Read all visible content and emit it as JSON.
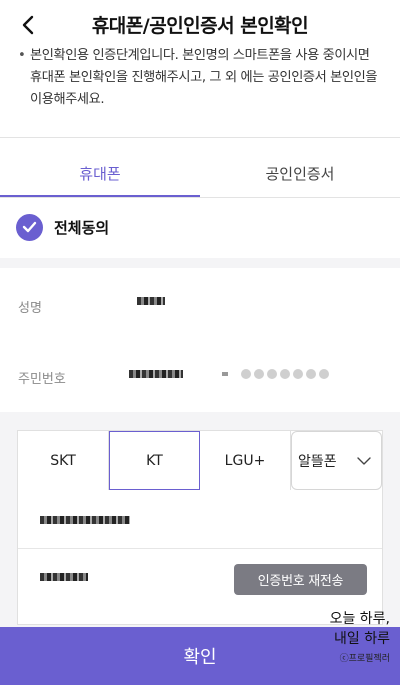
{
  "header": {
    "title": "휴대폰/공인인증서 본인확인",
    "back_icon": "chevron-left-icon"
  },
  "notice": {
    "text": "본인확인용 인증단계입니다. 본인명의 스마트폰을 사용 중이시면 휴대폰 본인확인을 진행해주시고, 그 외 에는 공인인증서 본인인을 이용해주세요."
  },
  "tabs": [
    {
      "label": "휴대폰",
      "active": true
    },
    {
      "label": "공인인증서",
      "active": false
    }
  ],
  "agree": {
    "label": "전체동의",
    "checked": true
  },
  "form": {
    "name_label": "성명",
    "rrn_label": "주민번호"
  },
  "carriers": {
    "skt": "SKT",
    "kt": "KT",
    "lgu": "LGU+",
    "mvno": "알뜰폰",
    "selected": "KT"
  },
  "resend_button": "인증번호 재전송",
  "confirm_button": "확인",
  "watermark": {
    "line1": "오늘 하루,",
    "line2": "내일 하루",
    "credit": "ⓒ프로필젝러"
  },
  "colors": {
    "accent": "#6a5fd0",
    "button_gray": "#7b7b83"
  }
}
